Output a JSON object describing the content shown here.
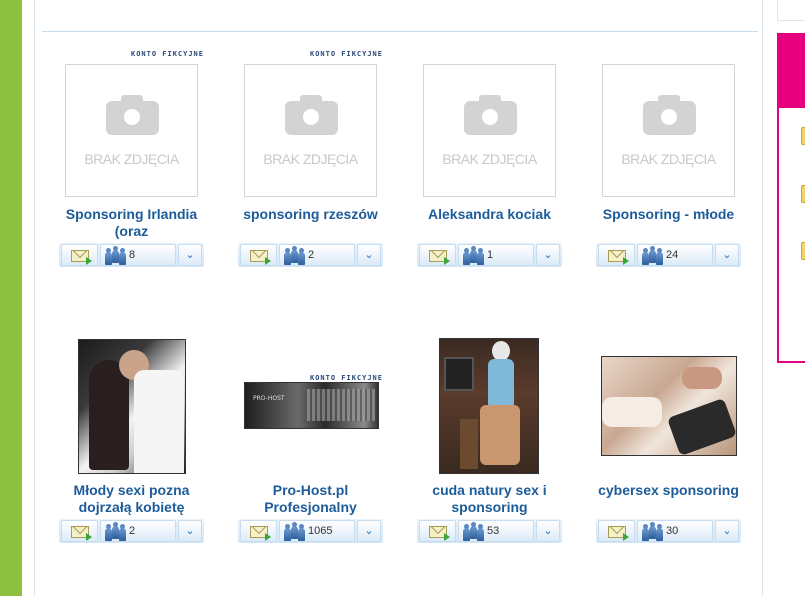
{
  "badge_text": "KONTO FIKCYJNE",
  "placeholder_text": "BRAK ZDJĘCIA",
  "colors": {
    "accent_green": "#8dc03f",
    "accent_pink": "#e6007e",
    "title_blue": "#1d5c9a"
  },
  "icons": {
    "message": "envelope-icon",
    "friends": "people-icon",
    "more": "chevron-down-icon"
  },
  "profiles": [
    {
      "title": "Sponsoring Irlandia (oraz",
      "count": "8",
      "badge": true,
      "photo": "none"
    },
    {
      "title": "sponsoring rzeszów",
      "count": "2",
      "badge": true,
      "photo": "none"
    },
    {
      "title": "Aleksandra kociak",
      "count": "1",
      "badge": false,
      "photo": "none"
    },
    {
      "title": "Sponsoring - młode",
      "count": "24",
      "badge": false,
      "photo": "none"
    },
    {
      "title": "Młody sexi pozna dojrzałą kobietę",
      "count": "2",
      "badge": false,
      "photo": "couple"
    },
    {
      "title": "Pro-Host.pl Profesjonalny",
      "count": "1065",
      "badge": true,
      "photo": "server"
    },
    {
      "title": "cuda natury sex i sponsoring",
      "count": "53",
      "badge": false,
      "photo": "woman"
    },
    {
      "title": "cybersex sponsoring",
      "count": "30",
      "badge": false,
      "photo": "hands"
    }
  ]
}
